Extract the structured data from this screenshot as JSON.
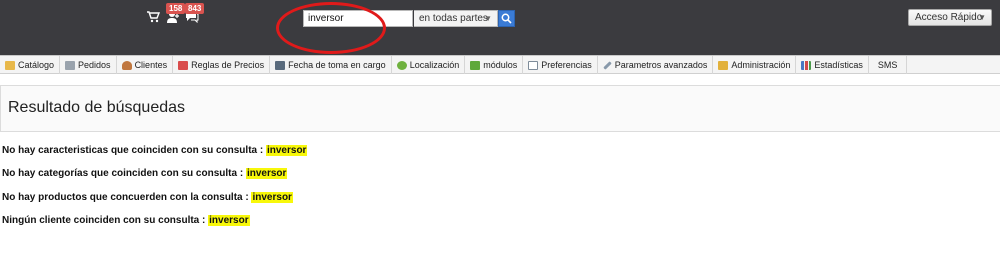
{
  "header": {
    "notifications": {
      "customers_count": "158",
      "messages_count": "843"
    },
    "search": {
      "query": "inversor",
      "scope": "en todas partes"
    },
    "quick_access_label": "Acceso Rápido"
  },
  "menu": [
    {
      "label": "Catálogo",
      "icon": "folder-icon",
      "color": "#e8b84a"
    },
    {
      "label": "Pedidos",
      "icon": "cart-icon",
      "color": "#9aa3ad"
    },
    {
      "label": "Clientes",
      "icon": "user-icon",
      "color": "#c0773f"
    },
    {
      "label": "Reglas de Precios",
      "icon": "price-rules-icon",
      "color": "#d94c4c"
    },
    {
      "label": "Fecha de toma en cargo",
      "icon": "truck-icon",
      "color": "#5a6b7d"
    },
    {
      "label": "Localización",
      "icon": "globe-icon",
      "color": "#6fb13f"
    },
    {
      "label": "módulos",
      "icon": "puzzle-icon",
      "color": "#5fa83a"
    },
    {
      "label": "Preferencias",
      "icon": "monitor-icon",
      "color": "#7d8b99"
    },
    {
      "label": "Parametros avanzados",
      "icon": "wrench-icon",
      "color": "#8899aa"
    },
    {
      "label": "Administración",
      "icon": "key-icon",
      "color": "#e2b13c"
    },
    {
      "label": "Estadísticas",
      "icon": "bar-chart-icon",
      "color": "#4a78c2"
    },
    {
      "label": "SMS",
      "icon": "",
      "color": ""
    }
  ],
  "page": {
    "title": "Resultado de búsquedas"
  },
  "results": [
    {
      "text": "No hay caracteristicas que coinciden con su consulta :",
      "term": "inversor"
    },
    {
      "text": "No hay categorías que coinciden con su consulta :",
      "term": "inversor"
    },
    {
      "text": "No hay productos que concuerden con la consulta :",
      "term": "inversor"
    },
    {
      "text": "Ningún cliente coinciden con su consulta :",
      "term": "inversor"
    }
  ]
}
